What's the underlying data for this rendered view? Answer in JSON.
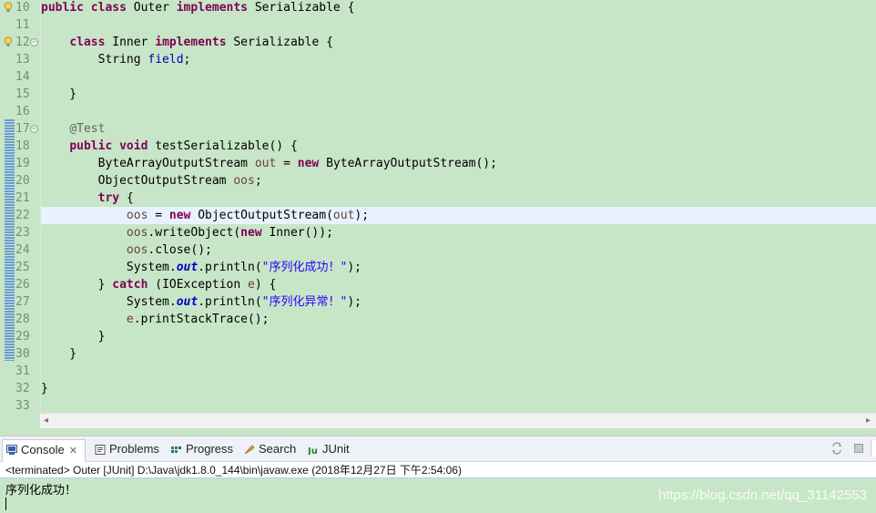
{
  "editor": {
    "lines": [
      {
        "num": "10",
        "html": "<span class=\"kw\">public</span> <span class=\"kw\">class</span> Outer <span class=\"kw\">implements</span> Serializable {"
      },
      {
        "num": "11",
        "html": ""
      },
      {
        "num": "12",
        "html": "    <span class=\"kw\">class</span> Inner <span class=\"kw\">implements</span> Serializable {"
      },
      {
        "num": "13",
        "html": "        String <span class=\"field\">field</span>;"
      },
      {
        "num": "14",
        "html": ""
      },
      {
        "num": "15",
        "html": "    }"
      },
      {
        "num": "16",
        "html": ""
      },
      {
        "num": "17",
        "html": "    <span class=\"ann\">@Test</span>"
      },
      {
        "num": "18",
        "html": "    <span class=\"kw\">public</span> <span class=\"kw\">void</span> testSerializable() {"
      },
      {
        "num": "19",
        "html": "        ByteArrayOutputStream <span class=\"var\">out</span> = <span class=\"kw\">new</span> ByteArrayOutputStream();"
      },
      {
        "num": "20",
        "html": "        ObjectOutputStream <span class=\"var\">oos</span>;"
      },
      {
        "num": "21",
        "html": "        <span class=\"kw\">try</span> {"
      },
      {
        "num": "22",
        "html": "            <span class=\"var\">oos</span> = <span class=\"kw\">new</span> ObjectOutputStream(<span class=\"var\">out</span>);"
      },
      {
        "num": "23",
        "html": "            <span class=\"var\">oos</span>.writeObject(<span class=\"kw\">new</span> Inner());"
      },
      {
        "num": "24",
        "html": "            <span class=\"var\">oos</span>.close();"
      },
      {
        "num": "25",
        "html": "            System.<span class=\"static\">out</span>.println(<span class=\"str\">\"序列化成功！\"</span>);"
      },
      {
        "num": "26",
        "html": "        } <span class=\"kw\">catch</span> (IOException <span class=\"var\">e</span>) {"
      },
      {
        "num": "27",
        "html": "            System.<span class=\"static\">out</span>.println(<span class=\"str\">\"序列化异常！\"</span>);"
      },
      {
        "num": "28",
        "html": "            <span class=\"var\">e</span>.printStackTrace();"
      },
      {
        "num": "29",
        "html": "        }"
      },
      {
        "num": "30",
        "html": "    }"
      },
      {
        "num": "31",
        "html": ""
      },
      {
        "num": "32",
        "html": "}"
      },
      {
        "num": "33",
        "html": ""
      }
    ]
  },
  "panel": {
    "tabs": {
      "console": "Console",
      "console_close": "✕",
      "problems": "Problems",
      "progress": "Progress",
      "search": "Search",
      "junit": "JUnit"
    },
    "status": "<terminated> Outer [JUnit] D:\\Java\\jdk1.8.0_144\\bin\\javaw.exe (2018年12月27日 下午2:54:06)",
    "output": "序列化成功！",
    "watermark": "https://blog.csdn.net/qq_31142553"
  },
  "colors": {
    "editor_bg": "#c7e6c7",
    "keyword": "#7f0055",
    "string": "#2a00ff",
    "field": "#0000c0",
    "current_line": "#e8f2fe"
  },
  "icons": [
    "lightbulb-warning-icon",
    "fold-minus-icon",
    "console-icon",
    "problems-icon",
    "progress-icon",
    "search-icon",
    "junit-icon",
    "sync-icon",
    "terminate-icon",
    "scrollbar-left-arrow",
    "scrollbar-right-arrow"
  ]
}
